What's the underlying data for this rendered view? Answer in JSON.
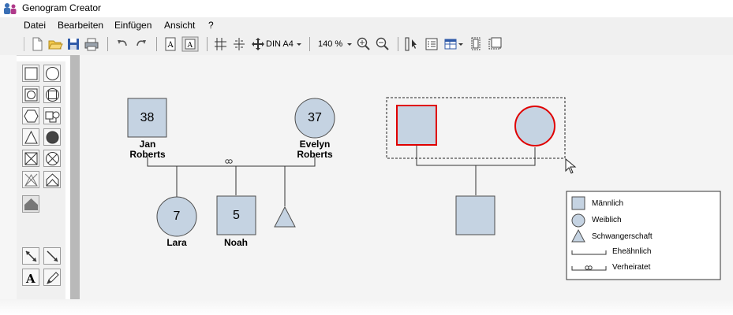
{
  "app": {
    "title": "Genogram Creator"
  },
  "menu": [
    "Datei",
    "Bearbeiten",
    "Einfügen",
    "Ansicht",
    "?"
  ],
  "toolbar": {
    "page_size": "DIN A4",
    "zoom": "140 %"
  },
  "family1": {
    "father": {
      "age": "38",
      "name": "Jan\nRoberts"
    },
    "mother": {
      "age": "37",
      "name": "Evelyn\nRoberts"
    },
    "children": [
      {
        "type": "female",
        "age": "7",
        "name": "Lara"
      },
      {
        "type": "male",
        "age": "5",
        "name": "Noah"
      },
      {
        "type": "pregnancy"
      }
    ]
  },
  "legend": {
    "items": [
      {
        "label": "Männlich"
      },
      {
        "label": "Weiblich"
      },
      {
        "label": "Schwangerschaft"
      },
      {
        "label": "Eheähnlich"
      },
      {
        "label": "Verheiratet"
      }
    ]
  },
  "colors": {
    "node_fill": "#c5d3e2",
    "node_stroke": "#4d4d4d",
    "selection": "#e00000",
    "canvas": "#f4f4f4"
  }
}
